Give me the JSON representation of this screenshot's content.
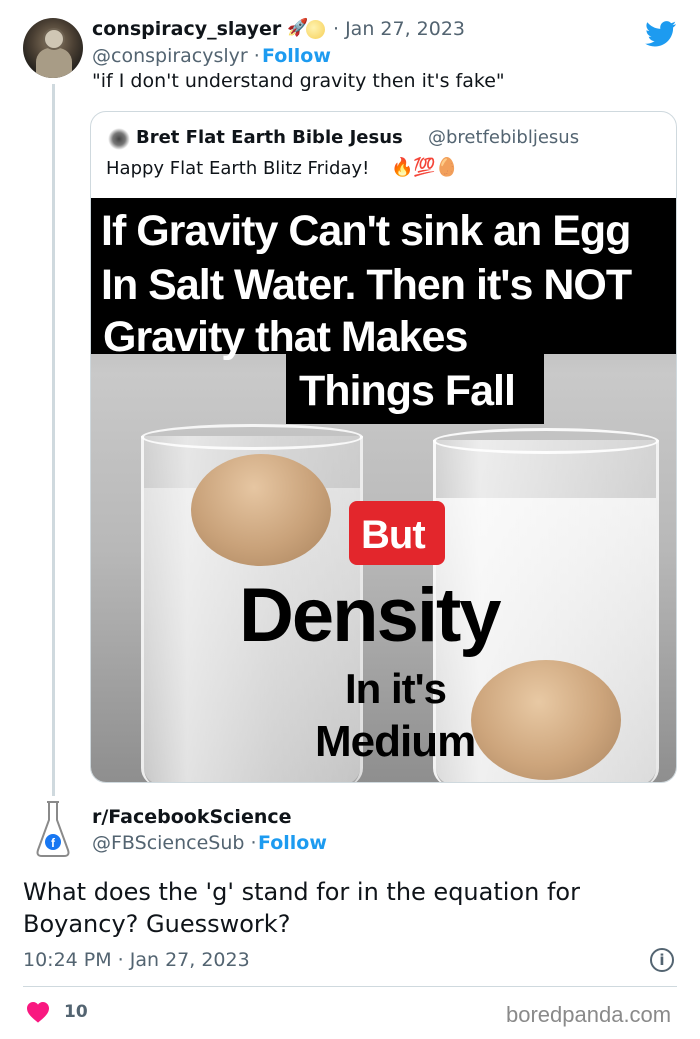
{
  "tweet": {
    "author_name": "conspiracy_slayer",
    "author_badges": [
      "rocket-emoji",
      "moon-emoji"
    ],
    "date": "· Jan 27, 2023",
    "handle": "@conspiracyslyr ·",
    "follow_label": "Follow",
    "text": "\"if I don't understand gravity then it's fake\""
  },
  "quoted": {
    "author_name": "Bret Flat Earth Bible Jesus",
    "handle": "@bretfebibljesus",
    "text": "Happy Flat Earth Blitz Friday!",
    "emojis": "🔥💯🥚",
    "meme": {
      "line1": "If Gravity Can't sink an Egg",
      "line2": "In Salt Water. Then it's NOT",
      "line3": "Gravity that  Makes",
      "line4": "Things Fall",
      "but": "But",
      "density": "Density",
      "in_its": "In it's",
      "medium": "Medium"
    }
  },
  "reply": {
    "author_name": "r/FacebookScience",
    "handle": "@FBScienceSub ·",
    "follow_label": "Follow",
    "text": "What does the 'g' stand for in the equation for Boyancy? Guesswork?",
    "timestamp": "10:24 PM · Jan 27, 2023",
    "likes": "10"
  },
  "watermark": "boredpanda.com",
  "colors": {
    "accent": "#1d9bf0",
    "secondary_text": "#536471",
    "heart": "#f91880",
    "but_box": "#e3262c"
  }
}
